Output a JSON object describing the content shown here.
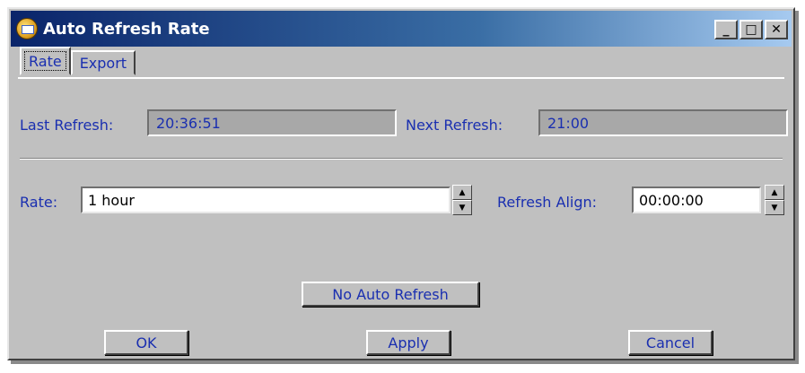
{
  "window": {
    "title": "Auto Refresh Rate",
    "icon": "app-envelope-icon",
    "controls": {
      "minimize": "_",
      "maximize": "□",
      "close": "✕"
    }
  },
  "tabs": [
    {
      "label": "Rate",
      "selected": true
    },
    {
      "label": "Export",
      "selected": false
    }
  ],
  "refresh_info": {
    "last_label": "Last Refresh:",
    "last_value": "20:36:51",
    "next_label": "Next Refresh:",
    "next_value": "21:00"
  },
  "rate": {
    "label": "Rate:",
    "value": "1 hour"
  },
  "align": {
    "label": "Refresh Align:",
    "value": "00:00:00"
  },
  "buttons": {
    "no_auto_refresh": "No Auto Refresh",
    "ok": "OK",
    "apply": "Apply",
    "cancel": "Cancel"
  }
}
